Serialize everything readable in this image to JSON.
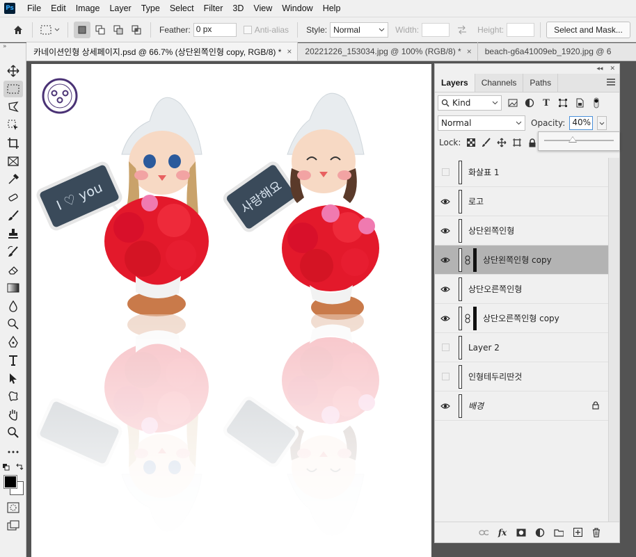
{
  "app": {
    "logo": "Ps"
  },
  "menu": [
    "File",
    "Edit",
    "Image",
    "Layer",
    "Type",
    "Select",
    "Filter",
    "3D",
    "View",
    "Window",
    "Help"
  ],
  "options": {
    "feather_label": "Feather:",
    "feather_value": "0 px",
    "antialias_label": "Anti-alias",
    "style_label": "Style:",
    "style_value": "Normal",
    "width_label": "Width:",
    "height_label": "Height:",
    "select_mask_label": "Select and Mask..."
  },
  "tabs": [
    {
      "label": "카네이션인형 상세페이지.psd @ 66.7% (상단왼쪽인형 copy, RGB/8) *",
      "active": true
    },
    {
      "label": "20221226_153034.jpg @ 100% (RGB/8) *",
      "active": false
    },
    {
      "label": "beach-g6a41009eb_1920.jpg @ 6",
      "active": false
    }
  ],
  "tab_close": "×",
  "panel": {
    "tabs": [
      "Layers",
      "Channels",
      "Paths"
    ],
    "kind_label": "Kind",
    "blend_mode": "Normal",
    "opacity_label": "Opacity:",
    "opacity_value": "40%",
    "opacity_fraction": 0.4,
    "lock_label": "Lock:",
    "fx_label": "fx"
  },
  "layers": [
    {
      "name": "화살표 1",
      "visible": false,
      "linked": false,
      "masked": false,
      "selected": false,
      "italic": false,
      "locked": false
    },
    {
      "name": "로고",
      "visible": true,
      "linked": false,
      "masked": false,
      "selected": false,
      "italic": false,
      "locked": false
    },
    {
      "name": "상단왼쪽인형",
      "visible": true,
      "linked": false,
      "masked": false,
      "selected": false,
      "italic": false,
      "locked": false
    },
    {
      "name": "상단왼쪽인형 copy",
      "visible": true,
      "linked": true,
      "masked": true,
      "selected": true,
      "italic": false,
      "locked": false
    },
    {
      "name": "상단오른쪽인형",
      "visible": true,
      "linked": false,
      "masked": false,
      "selected": false,
      "italic": false,
      "locked": false
    },
    {
      "name": "상단오른쪽인형 copy",
      "visible": true,
      "linked": true,
      "masked": true,
      "selected": false,
      "italic": false,
      "locked": false
    },
    {
      "name": "Layer 2",
      "visible": false,
      "linked": false,
      "masked": false,
      "selected": false,
      "italic": false,
      "locked": false
    },
    {
      "name": "인형테두리딴것",
      "visible": false,
      "linked": false,
      "masked": false,
      "selected": false,
      "italic": false,
      "locked": false
    },
    {
      "name": "배경",
      "visible": true,
      "linked": false,
      "masked": false,
      "selected": false,
      "italic": true,
      "locked": true
    }
  ],
  "canvas": {
    "sign_left": "I ♡ you",
    "sign_right": "사랑해요"
  },
  "colors": {
    "foreground": "#000000",
    "background": "#ffffff",
    "selected_row": "#b3b3b3",
    "flower_red": "#e3192b"
  }
}
